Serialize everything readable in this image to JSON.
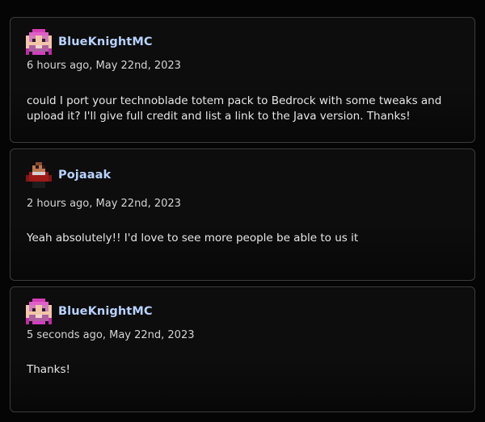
{
  "comments": [
    {
      "user": "BlueKnightMC",
      "avatar_icon": "pixel-face-avatar",
      "timestamp": "6 hours ago, May 22nd, 2023",
      "text": "could I port your technoblade totem pack to Bedrock with some tweaks and upload it? I'll give full credit and list a link to the Java version. Thanks!"
    },
    {
      "user": "Pojaaak",
      "avatar_icon": "pixel-character-avatar",
      "timestamp": "2 hours ago, May 22nd, 2023",
      "text": "Yeah absolutely!! I'd love to see more people be able to us it"
    },
    {
      "user": "BlueKnightMC",
      "avatar_icon": "pixel-face-avatar",
      "timestamp": "5 seconds ago, May 22nd, 2023",
      "text": "Thanks!"
    }
  ],
  "colors": {
    "background": "#050505",
    "card": "#0d0d0d",
    "border": "#3c3c3c",
    "username": "#b8d2ff",
    "text": "#e6e6e6"
  }
}
